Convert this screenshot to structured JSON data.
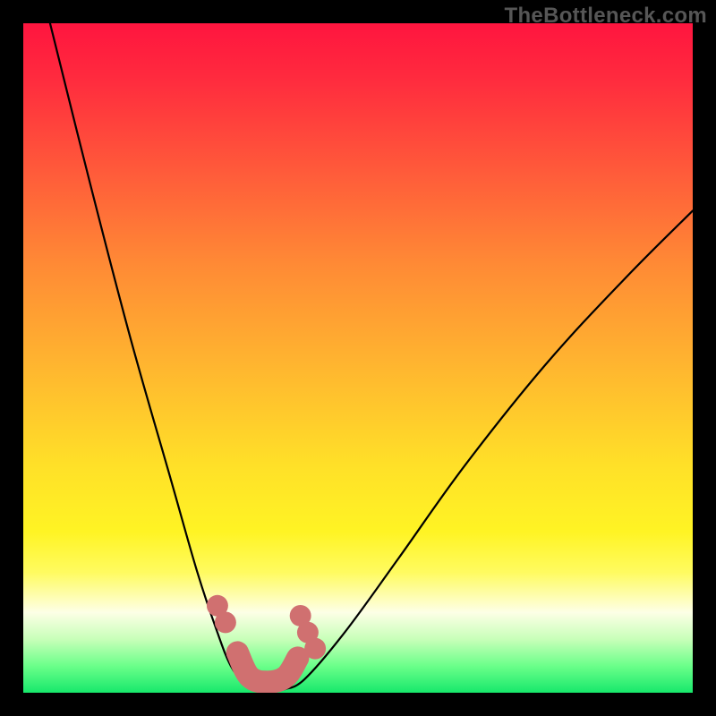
{
  "watermark": "TheBottleneck.com",
  "chart_data": {
    "type": "line",
    "title": "",
    "xlabel": "",
    "ylabel": "",
    "xlim": [
      0,
      100
    ],
    "ylim": [
      0,
      100
    ],
    "background": "rainbow-gradient (red top → green bottom)",
    "curves": [
      {
        "name": "left-descent",
        "description": "steep descending curve from top-left to valley",
        "x": [
          4,
          10,
          16,
          22,
          26,
          29,
          31,
          33,
          34.5
        ],
        "y": [
          100,
          76,
          53,
          32,
          18,
          9,
          4,
          1.5,
          0.5
        ]
      },
      {
        "name": "right-ascent",
        "description": "rising curve from valley toward upper-right",
        "x": [
          39,
          42,
          48,
          56,
          66,
          78,
          90,
          100
        ],
        "y": [
          0.5,
          2,
          9,
          20,
          34,
          49,
          62,
          72
        ]
      }
    ],
    "valley_markers": {
      "description": "reddish dots and thick segment near valley floor",
      "dots": [
        {
          "x": 29.0,
          "y": 13.0,
          "r": 1.6
        },
        {
          "x": 30.2,
          "y": 10.5,
          "r": 1.6
        },
        {
          "x": 41.4,
          "y": 11.5,
          "r": 1.6
        },
        {
          "x": 42.5,
          "y": 9.0,
          "r": 1.6
        },
        {
          "x": 43.6,
          "y": 6.6,
          "r": 1.6
        }
      ],
      "floor_segment": {
        "path": [
          {
            "x": 32.0,
            "y": 6.0
          },
          {
            "x": 33.8,
            "y": 2.4
          },
          {
            "x": 36.5,
            "y": 1.6
          },
          {
            "x": 39.2,
            "y": 2.4
          },
          {
            "x": 41.0,
            "y": 5.2
          }
        ],
        "width": 3.4
      },
      "color": "#d07070"
    }
  }
}
